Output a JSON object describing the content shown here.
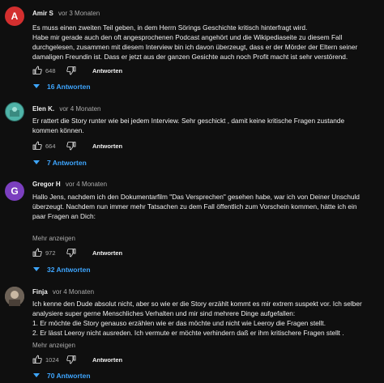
{
  "comments": [
    {
      "author": "Amir S",
      "time": "vor 3 Monaten",
      "avatar_letter": "A",
      "avatar_color": "#d32f2f",
      "text": [
        "Es muss einen zweiten Teil geben, in dem Herrn Sörings Geschichte kritisch hinterfragt wird.",
        "Habe mir gerade auch den oft angesprochenen Podcast angehört und die Wikipediaseite zu diesem Fall",
        "durchgelesen, zusammen mit diesem Interview bin ich davon überzeugt, dass er der Mörder der Eltern seiner",
        "damaligen Freundin ist. Dass er jetzt aus der ganzen Gesichte auch noch Profit macht ist sehr verstörend."
      ],
      "likes": "648",
      "reply_label": "Antworten",
      "replies": "16 Antworten"
    },
    {
      "author": "Elen K.",
      "time": "vor 4 Monaten",
      "avatar_color": "#4fb3a8",
      "text": [
        "Er rattert die Story runter wie bei jedem Interview. Sehr geschickt , damit keine kritische Fragen zustande",
        "kommen können."
      ],
      "likes": "664",
      "reply_label": "Antworten",
      "replies": "7 Antworten"
    },
    {
      "author": "Gregor H",
      "time": "vor 4 Monaten",
      "avatar_letter": "G",
      "avatar_color": "#7b3fbf",
      "text": [
        "Hallo Jens, nachdem ich den Dokumentarfilm \"Das Versprechen\" gesehen habe, war ich von Deiner Unschuld",
        "überzeugt. Nachdem nun immer mehr Tatsachen zu dem Fall öffentlich zum Vorschein kommen, hätte ich ein",
        "paar Fragen an Dich:"
      ],
      "more_label": "Mehr anzeigen",
      "likes": "972",
      "reply_label": "Antworten",
      "replies": "32 Antworten"
    },
    {
      "author": "Finja",
      "time": "vor 4 Monaten",
      "avatar_color": "#8a7a6a",
      "text": [
        "Ich kenne den Dude absolut nicht, aber so wie er die Story erzählt kommt es mir extrem suspekt vor. Ich selber",
        "analysiere super gerne Menschliches Verhalten und mir sind mehrere Dinge aufgefallen:",
        "1. Er möchte die Story genauso erzählen wie er das möchte und nicht wie Leeroy die Fragen stellt.",
        "2. Er lässt Leeroy nicht ausreden. Ich vermute er möchte verhindern daß er ihm kritischere Fragen stellt ."
      ],
      "more_label": "Mehr anzeigen",
      "likes": "1024",
      "reply_label": "Antworten",
      "replies": "70 Antworten"
    }
  ]
}
